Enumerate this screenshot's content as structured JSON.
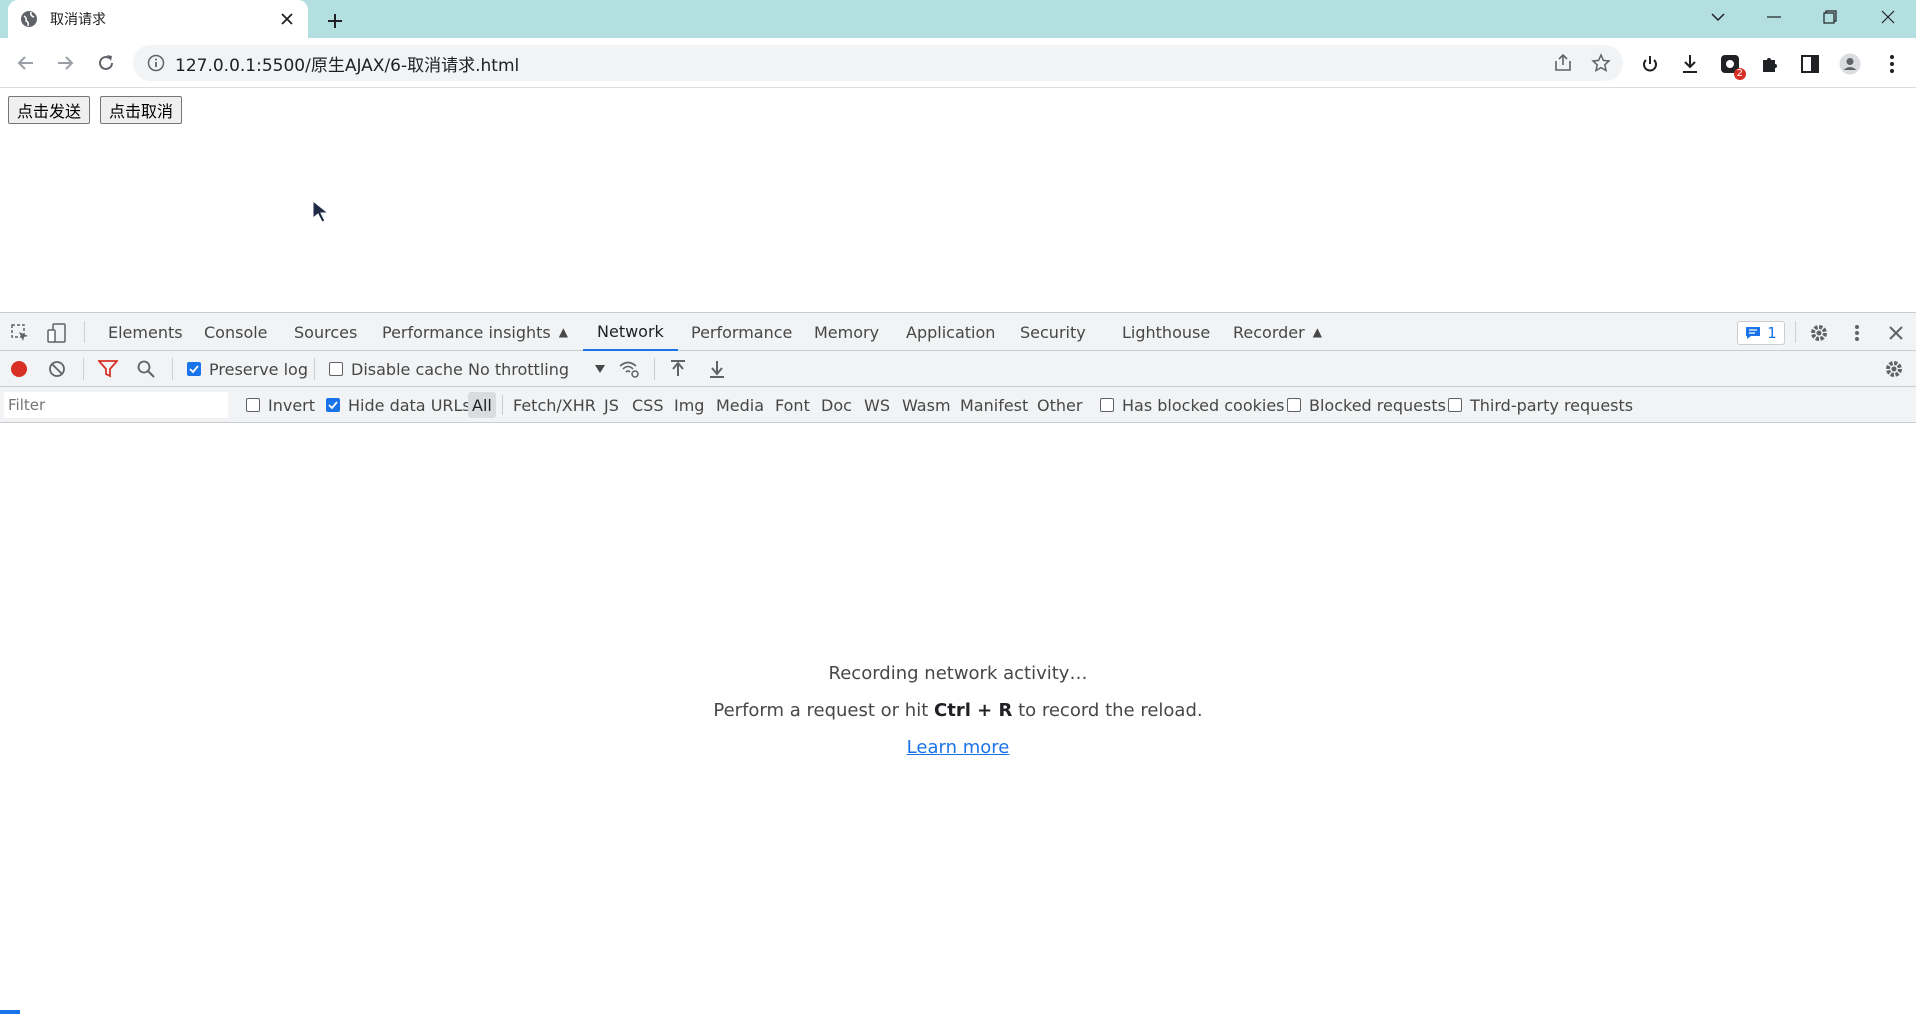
{
  "browser": {
    "tab_title": "取消请求",
    "url": "127.0.0.1:5500/原生AJAX/6-取消请求.html",
    "extension_badge": "2"
  },
  "page": {
    "send_button": "点击发送",
    "cancel_button": "点击取消"
  },
  "devtools": {
    "tabs": [
      "Elements",
      "Console",
      "Sources",
      "Performance insights",
      "Network",
      "Performance",
      "Memory",
      "Application",
      "Security",
      "Lighthouse",
      "Recorder"
    ],
    "active_tab": "Network",
    "issues_count": "1",
    "toolbar": {
      "preserve_log": "Preserve log",
      "preserve_log_checked": true,
      "disable_cache": "Disable cache",
      "disable_cache_checked": false,
      "throttling": "No throttling"
    },
    "filter_bar": {
      "placeholder": "Filter",
      "invert": "Invert",
      "hide_data_urls": "Hide data URLs",
      "hide_data_urls_checked": true,
      "types": [
        "All",
        "Fetch/XHR",
        "JS",
        "CSS",
        "Img",
        "Media",
        "Font",
        "Doc",
        "WS",
        "Wasm",
        "Manifest",
        "Other"
      ],
      "active_type": "All",
      "has_blocked_cookies": "Has blocked cookies",
      "blocked_requests": "Blocked requests",
      "third_party_requests": "Third-party requests"
    },
    "empty_state": {
      "line1": "Recording network activity…",
      "line2_prefix": "Perform a request or hit ",
      "line2_shortcut": "Ctrl + R",
      "line2_suffix": " to record the reload.",
      "link": "Learn more"
    }
  },
  "colors": {
    "accent": "#1a73e8",
    "record_red": "#d93025",
    "titlebar": "#b4dfe1"
  }
}
